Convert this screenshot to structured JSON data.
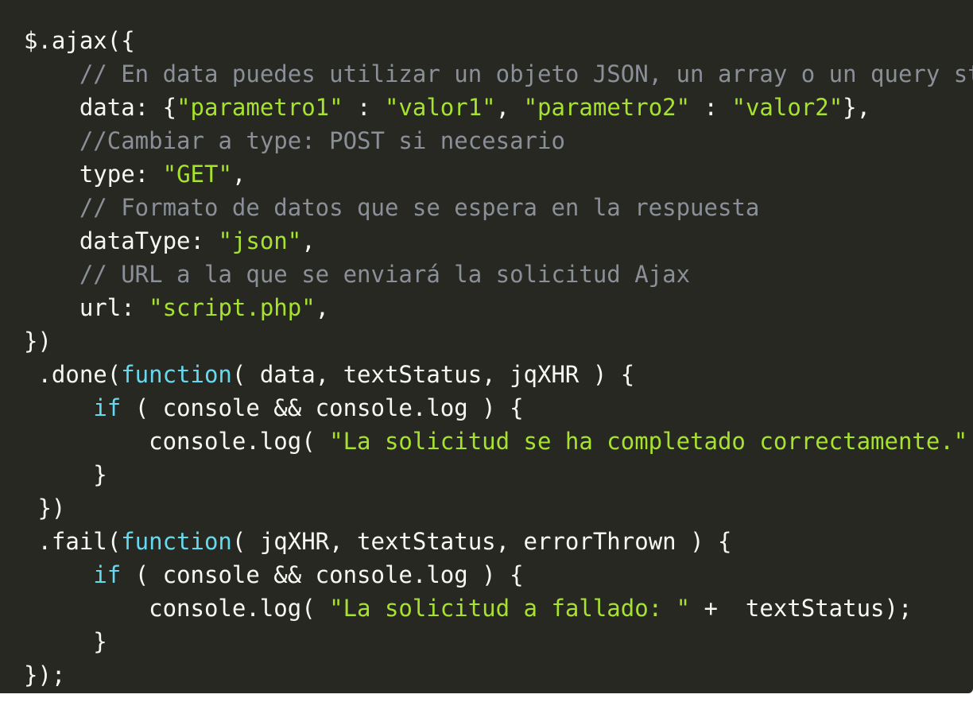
{
  "code": {
    "colors": {
      "background": "#272822",
      "plain": "#f8f8f2",
      "comment": "#8a8f98",
      "string": "#a6e22e",
      "keyword": "#66d9ef"
    },
    "lines": [
      [
        {
          "t": "plain",
          "v": "$.ajax({"
        }
      ],
      [
        {
          "t": "plain",
          "v": "    "
        },
        {
          "t": "comment",
          "v": "// En data puedes utilizar un objeto JSON, un array o un query string"
        }
      ],
      [
        {
          "t": "plain",
          "v": "    data: {"
        },
        {
          "t": "string",
          "v": "\"parametro1\""
        },
        {
          "t": "plain",
          "v": " : "
        },
        {
          "t": "string",
          "v": "\"valor1\""
        },
        {
          "t": "plain",
          "v": ", "
        },
        {
          "t": "string",
          "v": "\"parametro2\""
        },
        {
          "t": "plain",
          "v": " : "
        },
        {
          "t": "string",
          "v": "\"valor2\""
        },
        {
          "t": "plain",
          "v": "},"
        }
      ],
      [
        {
          "t": "plain",
          "v": "    "
        },
        {
          "t": "comment",
          "v": "//Cambiar a type: POST si necesario"
        }
      ],
      [
        {
          "t": "plain",
          "v": "    type: "
        },
        {
          "t": "string",
          "v": "\"GET\""
        },
        {
          "t": "plain",
          "v": ","
        }
      ],
      [
        {
          "t": "plain",
          "v": "    "
        },
        {
          "t": "comment",
          "v": "// Formato de datos que se espera en la respuesta"
        }
      ],
      [
        {
          "t": "plain",
          "v": "    dataType: "
        },
        {
          "t": "string",
          "v": "\"json\""
        },
        {
          "t": "plain",
          "v": ","
        }
      ],
      [
        {
          "t": "plain",
          "v": "    "
        },
        {
          "t": "comment",
          "v": "// URL a la que se enviará la solicitud Ajax"
        }
      ],
      [
        {
          "t": "plain",
          "v": "    url: "
        },
        {
          "t": "string",
          "v": "\"script.php\""
        },
        {
          "t": "plain",
          "v": ","
        }
      ],
      [
        {
          "t": "plain",
          "v": "})"
        }
      ],
      [
        {
          "t": "plain",
          "v": " .done("
        },
        {
          "t": "keyword",
          "v": "function"
        },
        {
          "t": "plain",
          "v": "( data, textStatus, jqXHR ) {"
        }
      ],
      [
        {
          "t": "plain",
          "v": "     "
        },
        {
          "t": "keyword",
          "v": "if"
        },
        {
          "t": "plain",
          "v": " ( console && console.log ) {"
        }
      ],
      [
        {
          "t": "plain",
          "v": "         console.log( "
        },
        {
          "t": "string",
          "v": "\"La solicitud se ha completado correctamente.\""
        },
        {
          "t": "plain",
          "v": " );"
        }
      ],
      [
        {
          "t": "plain",
          "v": "     }"
        }
      ],
      [
        {
          "t": "plain",
          "v": " })"
        }
      ],
      [
        {
          "t": "plain",
          "v": " .fail("
        },
        {
          "t": "keyword",
          "v": "function"
        },
        {
          "t": "plain",
          "v": "( jqXHR, textStatus, errorThrown ) {"
        }
      ],
      [
        {
          "t": "plain",
          "v": "     "
        },
        {
          "t": "keyword",
          "v": "if"
        },
        {
          "t": "plain",
          "v": " ( console && console.log ) {"
        }
      ],
      [
        {
          "t": "plain",
          "v": "         console.log( "
        },
        {
          "t": "string",
          "v": "\"La solicitud a fallado: \""
        },
        {
          "t": "plain",
          "v": " +  textStatus);"
        }
      ],
      [
        {
          "t": "plain",
          "v": "     }"
        }
      ],
      [
        {
          "t": "plain",
          "v": "});"
        }
      ]
    ]
  }
}
